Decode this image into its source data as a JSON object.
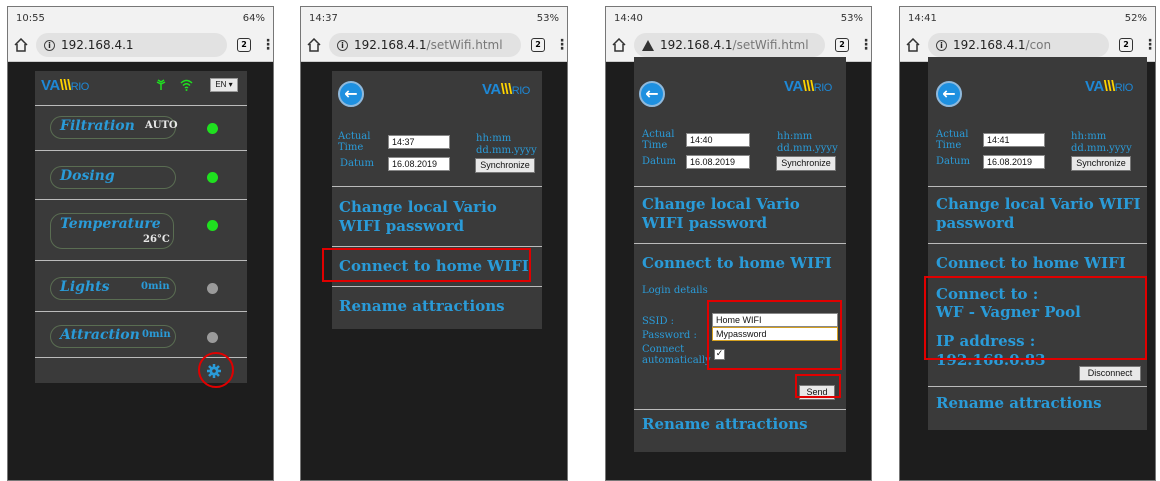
{
  "colors": {
    "accent_blue": "#2a9bd8",
    "status_green": "#1fe01f",
    "status_grey": "#9a9a9a",
    "highlight_red": "#e00000",
    "panel_bg": "#3a3a3a"
  },
  "logo": {
    "va": "VA",
    "bars": "\\\\\\",
    "rio": "RIO"
  },
  "screens": [
    {
      "status": {
        "time": "10:55",
        "battery": "64%"
      },
      "url": {
        "host": "192.168.4.1",
        "path": ""
      },
      "tabs_count": "2",
      "lang_select": "EN ▾",
      "items": [
        {
          "label": "Filtration",
          "sub": "AUTO",
          "status": "on"
        },
        {
          "label": "Dosing",
          "sub": "",
          "status": "on"
        },
        {
          "label": "Temperature",
          "sub": "26°C",
          "status": "on"
        },
        {
          "label": "Lights",
          "sub": "0min",
          "status": "off"
        },
        {
          "label": "Attraction",
          "sub": "0min",
          "status": "off"
        }
      ],
      "settings_icon": "gear-icon"
    },
    {
      "status": {
        "time": "14:37",
        "battery": "53%"
      },
      "url": {
        "host": "192.168.4.1",
        "path": "/setWifi.html"
      },
      "tabs_count": "2",
      "actual_time_label": "Actual\nTime",
      "datum_label": "Datum",
      "time_value": "14:37",
      "date_value": "16.08.2019",
      "time_format": "hh:mm",
      "date_format": "dd.mm.yyyy",
      "sync_label": "Synchronize",
      "change_pw": "Change local Vario WIFI password",
      "connect_home": "Connect to home WIFI",
      "rename": "Rename attractions"
    },
    {
      "status": {
        "time": "14:40",
        "battery": "53%"
      },
      "url": {
        "host": "192.168.4.1",
        "path": "/setWifi.html"
      },
      "tabs_count": "2",
      "actual_time_label": "Actual\nTime",
      "datum_label": "Datum",
      "time_value": "14:40",
      "date_value": "16.08.2019",
      "time_format": "hh:mm",
      "date_format": "dd.mm.yyyy",
      "sync_label": "Synchronize",
      "change_pw": "Change local Vario WIFI password",
      "connect_home": "Connect to home WIFI",
      "login_details": "Login details",
      "ssid_label": "SSID :",
      "ssid_value": "Home WIFI",
      "password_label": "Password :",
      "password_value": "Mypassword",
      "auto_label": "Connect\nautomatically",
      "auto_checked": true,
      "send_label": "Send",
      "rename": "Rename attractions"
    },
    {
      "status": {
        "time": "14:41",
        "battery": "52%"
      },
      "url": {
        "host": "192.168.4.1",
        "path": "/con"
      },
      "tabs_count": "2",
      "actual_time_label": "Actual\nTime",
      "datum_label": "Datum",
      "time_value": "14:41",
      "date_value": "16.08.2019",
      "time_format": "hh:mm",
      "date_format": "dd.mm.yyyy",
      "sync_label": "Synchronize",
      "change_pw": "Change local Vario WIFI password",
      "connect_home": "Connect to home WIFI",
      "connect_to": "Connect to :",
      "network": "WF - Vagner Pool",
      "ip_line": "IP address : 192.168.0.83",
      "disconnect_label": "Disconnect",
      "rename": "Rename attractions"
    }
  ]
}
